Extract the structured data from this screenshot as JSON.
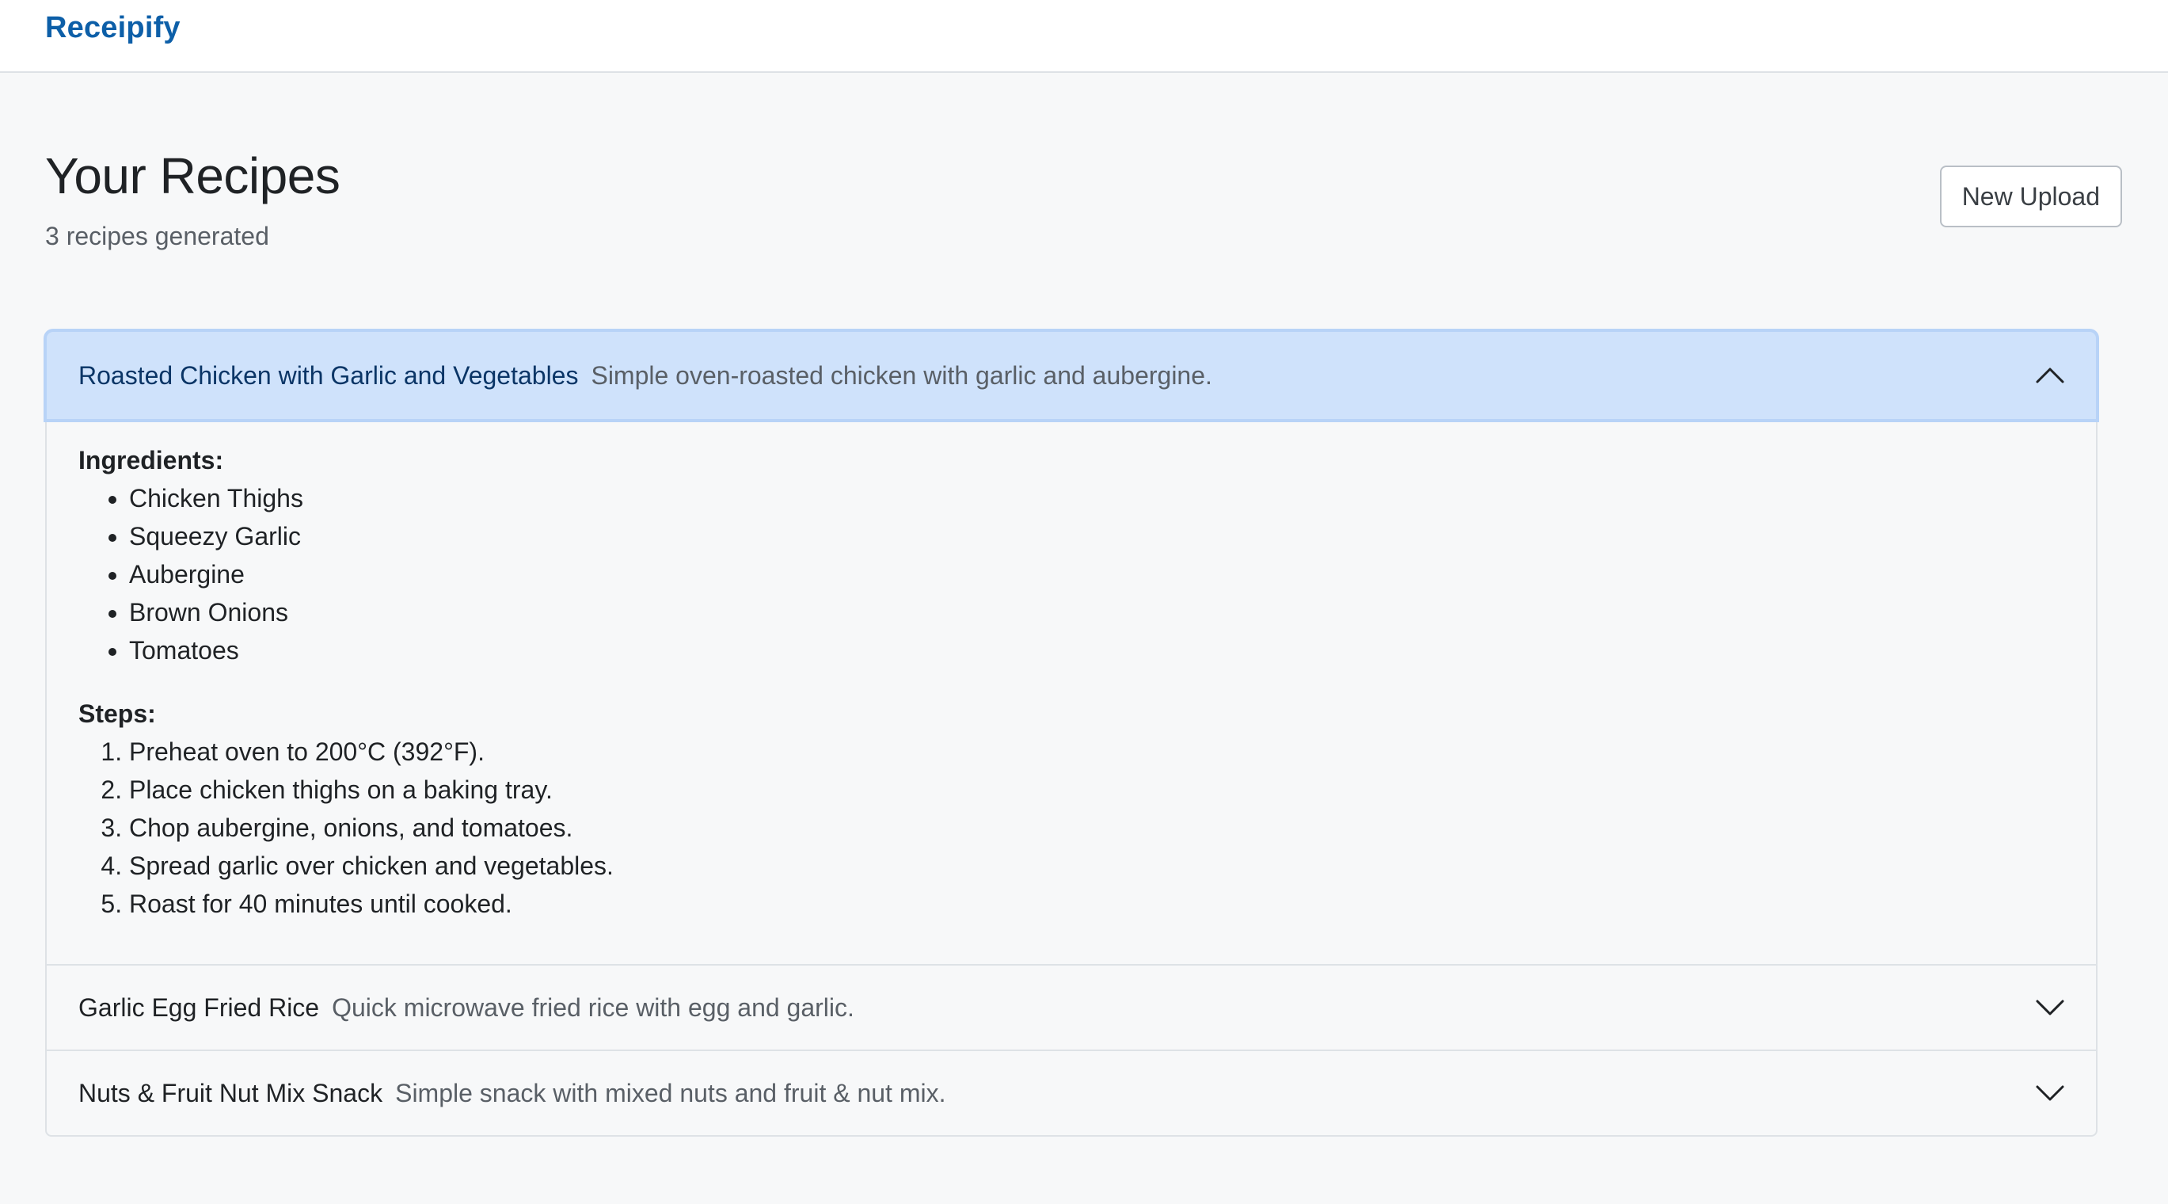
{
  "app": {
    "brand": "Receipify"
  },
  "header": {
    "title": "Your Recipes",
    "subtitle": "3 recipes generated",
    "new_upload_label": "New Upload"
  },
  "recipes": [
    {
      "title": "Roasted Chicken with Garlic and Vegetables",
      "description": "Simple oven-roasted chicken with garlic and aubergine.",
      "expanded": true,
      "ingredients_label": "Ingredients:",
      "ingredients": [
        "Chicken Thighs",
        "Squeezy Garlic",
        "Aubergine",
        "Brown Onions",
        "Tomatoes"
      ],
      "steps_label": "Steps:",
      "steps": [
        "Preheat oven to 200°C (392°F).",
        "Place chicken thighs on a baking tray.",
        "Chop aubergine, onions, and tomatoes.",
        "Spread garlic over chicken and vegetables.",
        "Roast for 40 minutes until cooked."
      ],
      "chevron_icon": "chevron-up-icon"
    },
    {
      "title": "Garlic Egg Fried Rice",
      "description": "Quick microwave fried rice with egg and garlic.",
      "expanded": false,
      "chevron_icon": "chevron-down-icon"
    },
    {
      "title": "Nuts & Fruit Nut Mix Snack",
      "description": "Simple snack with mixed nuts and fruit & nut mix.",
      "expanded": false,
      "chevron_icon": "chevron-down-icon"
    }
  ],
  "colors": {
    "brand": "#0d5fa8",
    "active_header_bg": "#cfe2fb",
    "page_bg": "#f7f8f9"
  }
}
